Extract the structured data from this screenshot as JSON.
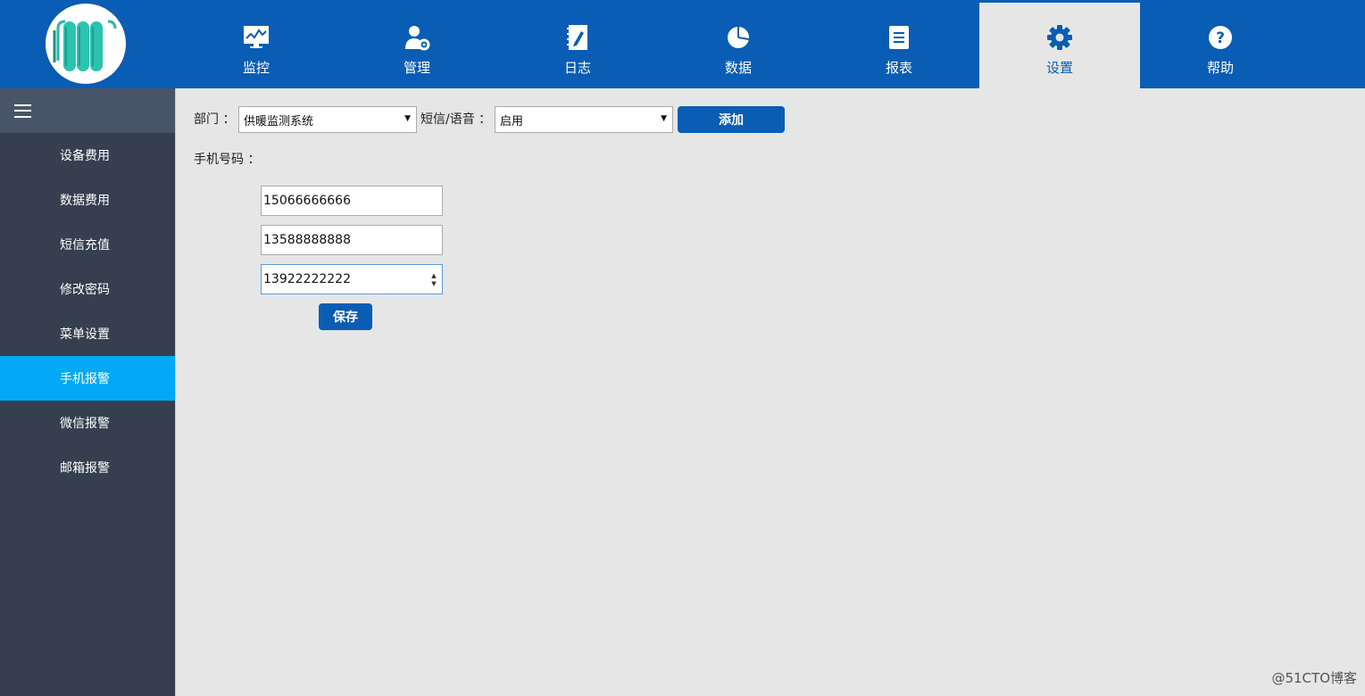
{
  "header": {
    "logo_icon": "radiator-logo-icon",
    "nav": [
      {
        "label": "监控",
        "icon": "monitor-chart-icon"
      },
      {
        "label": "管理",
        "icon": "user-gear-icon"
      },
      {
        "label": "日志",
        "icon": "notebook-pen-icon"
      },
      {
        "label": "数据",
        "icon": "pie-chart-icon"
      },
      {
        "label": "报表",
        "icon": "report-document-icon"
      },
      {
        "label": "设置",
        "icon": "gear-icon",
        "active": true
      },
      {
        "label": "帮助",
        "icon": "help-circle-icon"
      }
    ]
  },
  "sidebar": {
    "menu_icon": "hamburger-menu-icon",
    "items": [
      {
        "label": "设备费用"
      },
      {
        "label": "数据费用"
      },
      {
        "label": "短信充值"
      },
      {
        "label": "修改密码"
      },
      {
        "label": "菜单设置"
      },
      {
        "label": "手机报警",
        "active": true
      },
      {
        "label": "微信报警"
      },
      {
        "label": "邮箱报警"
      }
    ]
  },
  "form": {
    "department_label": "部门 ：",
    "department_value": "供暖监测系统",
    "sms_voice_label": "短信/语音 ：",
    "sms_voice_value": "启用",
    "add_button": "添加",
    "phone_label": "手机号码  ：",
    "phones": [
      "15066666666",
      "13588888888",
      "13922222222"
    ],
    "save_button": "保存"
  },
  "watermark": "@51CTO博客",
  "colors": {
    "header_bg": "#0a5db4",
    "sidebar_bg": "#353f4f",
    "sidebar_active": "#03a9f4",
    "content_bg": "#e6e6e6",
    "button_bg": "#0a5db4"
  }
}
